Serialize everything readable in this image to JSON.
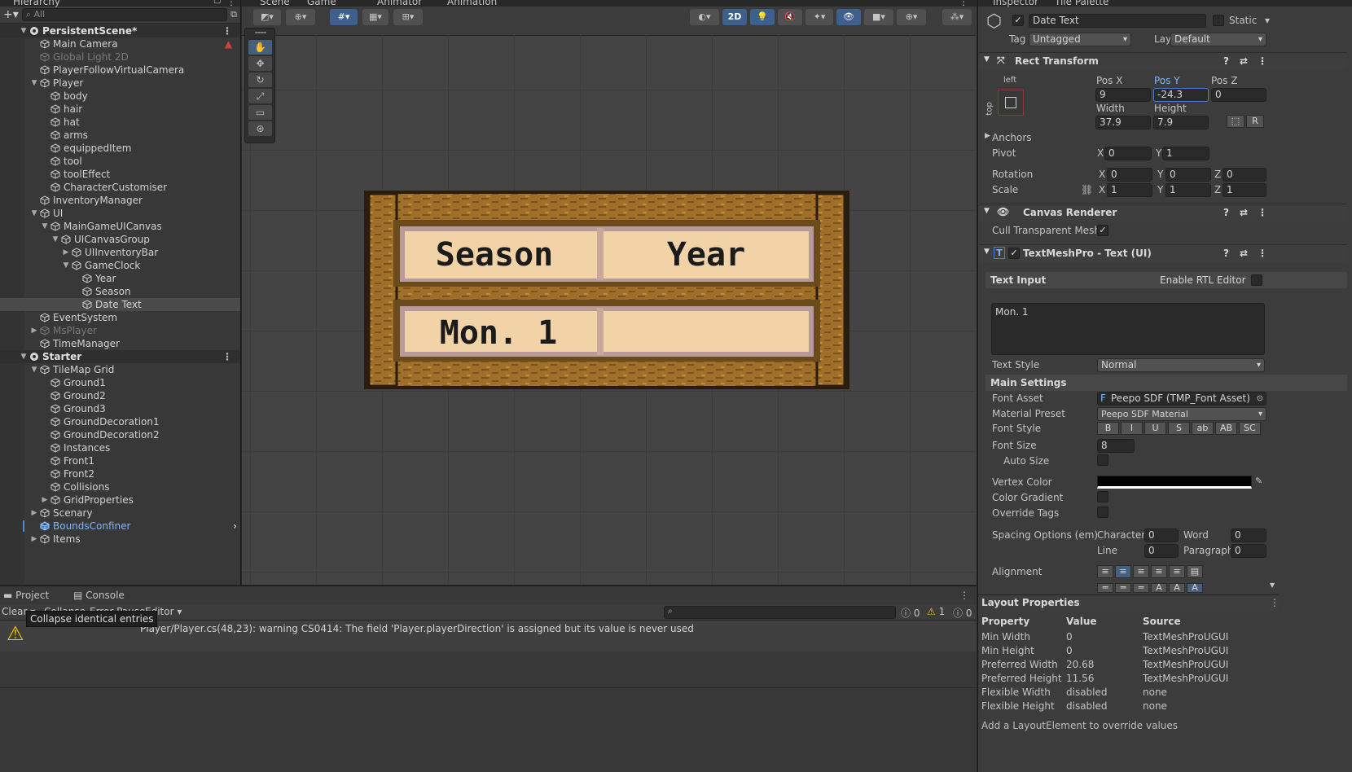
{
  "hierarchy": {
    "tab": "Hierarchy",
    "search_placeholder": "All",
    "nodes": [
      {
        "label": "PersistentScene*",
        "scene": true,
        "arrow": "▼"
      },
      {
        "label": "Main Camera"
      },
      {
        "label": "Global Light 2D",
        "dim": true
      },
      {
        "label": "PlayerFollowVirtualCamera"
      },
      {
        "label": "Player",
        "arrow": "▼"
      },
      {
        "label": "body"
      },
      {
        "label": "hair"
      },
      {
        "label": "hat"
      },
      {
        "label": "arms"
      },
      {
        "label": "equippedItem"
      },
      {
        "label": "tool"
      },
      {
        "label": "toolEffect"
      },
      {
        "label": "CharacterCustomiser"
      },
      {
        "label": "InventoryManager"
      },
      {
        "label": "UI",
        "arrow": "▼"
      },
      {
        "label": "MainGameUICanvas",
        "arrow": "▼"
      },
      {
        "label": "UICanvasGroup",
        "arrow": "▼"
      },
      {
        "label": "UIInventoryBar",
        "arrow": "▶"
      },
      {
        "label": "GameClock",
        "arrow": "▼"
      },
      {
        "label": "Year"
      },
      {
        "label": "Season"
      },
      {
        "label": "Date Text",
        "selected": true
      },
      {
        "label": "EventSystem"
      },
      {
        "label": "MsPlayer",
        "dim": true,
        "arrow": "▶"
      },
      {
        "label": "TimeManager"
      },
      {
        "label": "Starter",
        "scene": true,
        "arrow": "▼"
      },
      {
        "label": "TileMap Grid",
        "arrow": "▼"
      },
      {
        "label": "Ground1"
      },
      {
        "label": "Ground2"
      },
      {
        "label": "Ground3"
      },
      {
        "label": "GroundDecoration1"
      },
      {
        "label": "GroundDecoration2"
      },
      {
        "label": "Instances"
      },
      {
        "label": "Front1"
      },
      {
        "label": "Front2"
      },
      {
        "label": "Collisions"
      },
      {
        "label": "GridProperties",
        "arrow": "▶"
      },
      {
        "label": "Scenary",
        "arrow": "▶"
      },
      {
        "label": "BoundsConfiner",
        "prefab": true
      },
      {
        "label": "Items",
        "arrow": "▶"
      }
    ]
  },
  "scene": {
    "tabs": [
      "Scene",
      "Game",
      "Animator",
      "Animation"
    ],
    "mode_2d": "2D",
    "clock": {
      "season": "Season",
      "year": "Year",
      "date": "Mon. 1"
    }
  },
  "inspector": {
    "tabs": [
      "Inspector",
      "Tile Palette"
    ],
    "object_name": "Date Text",
    "static_label": "Static",
    "tag_label": "Tag",
    "tag_value": "Untagged",
    "layer_label": "Layer",
    "layer_value": "Default",
    "rect_transform": {
      "title": "Rect Transform",
      "anchor_h": "left",
      "anchor_v": "top",
      "pos_x_label": "Pos X",
      "pos_x": "9",
      "pos_y_label": "Pos Y",
      "pos_y": "-24.3",
      "pos_z_label": "Pos Z",
      "pos_z": "0",
      "width_label": "Width",
      "width": "37.9",
      "height_label": "Height",
      "height": "7.9",
      "r_btn": "R",
      "anchors_label": "Anchors",
      "pivot_label": "Pivot",
      "pivot_x": "0",
      "pivot_y": "1",
      "rotation_label": "Rotation",
      "rot_x": "0",
      "rot_y": "0",
      "rot_z": "0",
      "scale_label": "Scale",
      "scale_x": "1",
      "scale_y": "1",
      "scale_z": "1",
      "x": "X",
      "y": "Y",
      "z": "Z"
    },
    "canvas_renderer": {
      "title": "Canvas Renderer",
      "cull_label": "Cull Transparent Mesh"
    },
    "tmp": {
      "title": "TextMeshPro - Text (UI)",
      "text_input_label": "Text Input",
      "rtl_label": "Enable RTL Editor",
      "text_value": "Mon. 1",
      "text_style_label": "Text Style",
      "text_style_value": "Normal",
      "main_settings": "Main Settings",
      "font_asset_label": "Font Asset",
      "font_asset_value": "Peepo SDF (TMP_Font Asset)",
      "material_label": "Material Preset",
      "material_value": "Peepo SDF Material",
      "font_style_label": "Font Style",
      "font_styles": [
        "B",
        "I",
        "U",
        "S",
        "ab",
        "AB",
        "SC"
      ],
      "font_size_label": "Font Size",
      "font_size_value": "8",
      "auto_size_label": "Auto Size",
      "vertex_color_label": "Vertex Color",
      "color_gradient_label": "Color Gradient",
      "override_tags_label": "Override Tags",
      "spacing_label": "Spacing Options (em)",
      "character_label": "Character",
      "character_value": "0",
      "word_label": "Word",
      "word_value": "0",
      "line_label": "Line",
      "line_value": "0",
      "paragraph_label": "Paragraph",
      "paragraph_value": "0",
      "alignment_label": "Alignment"
    },
    "layout": {
      "title": "Layout Properties",
      "headers": [
        "Property",
        "Value",
        "Source"
      ],
      "rows": [
        [
          "Min Width",
          "0",
          "TextMeshProUGUI"
        ],
        [
          "Min Height",
          "0",
          "TextMeshProUGUI"
        ],
        [
          "Preferred Width",
          "20.68",
          "TextMeshProUGUI"
        ],
        [
          "Preferred Height",
          "11.56",
          "TextMeshProUGUI"
        ],
        [
          "Flexible Width",
          "disabled",
          "none"
        ],
        [
          "Flexible Height",
          "disabled",
          "none"
        ]
      ],
      "footer": "Add a LayoutElement to override values"
    }
  },
  "console": {
    "tabs": [
      "Project",
      "Console"
    ],
    "clear": "Clear",
    "collapse": "Collapse",
    "error_pause": "Error Pause",
    "editor": "Editor",
    "tooltip": "Collapse identical entries",
    "count_info": "0",
    "count_warn": "1",
    "count_err": "0",
    "message": "Player/Player.cs(48,23): warning CS0414: The field 'Player.playerDirection' is assigned but its value is never used"
  },
  "colors": {
    "selection": "#46607c",
    "accent": "#3f5f8d",
    "prefab": "#7fb6ff",
    "wood": "#a0702a",
    "parchment": "#f2d3a8"
  }
}
